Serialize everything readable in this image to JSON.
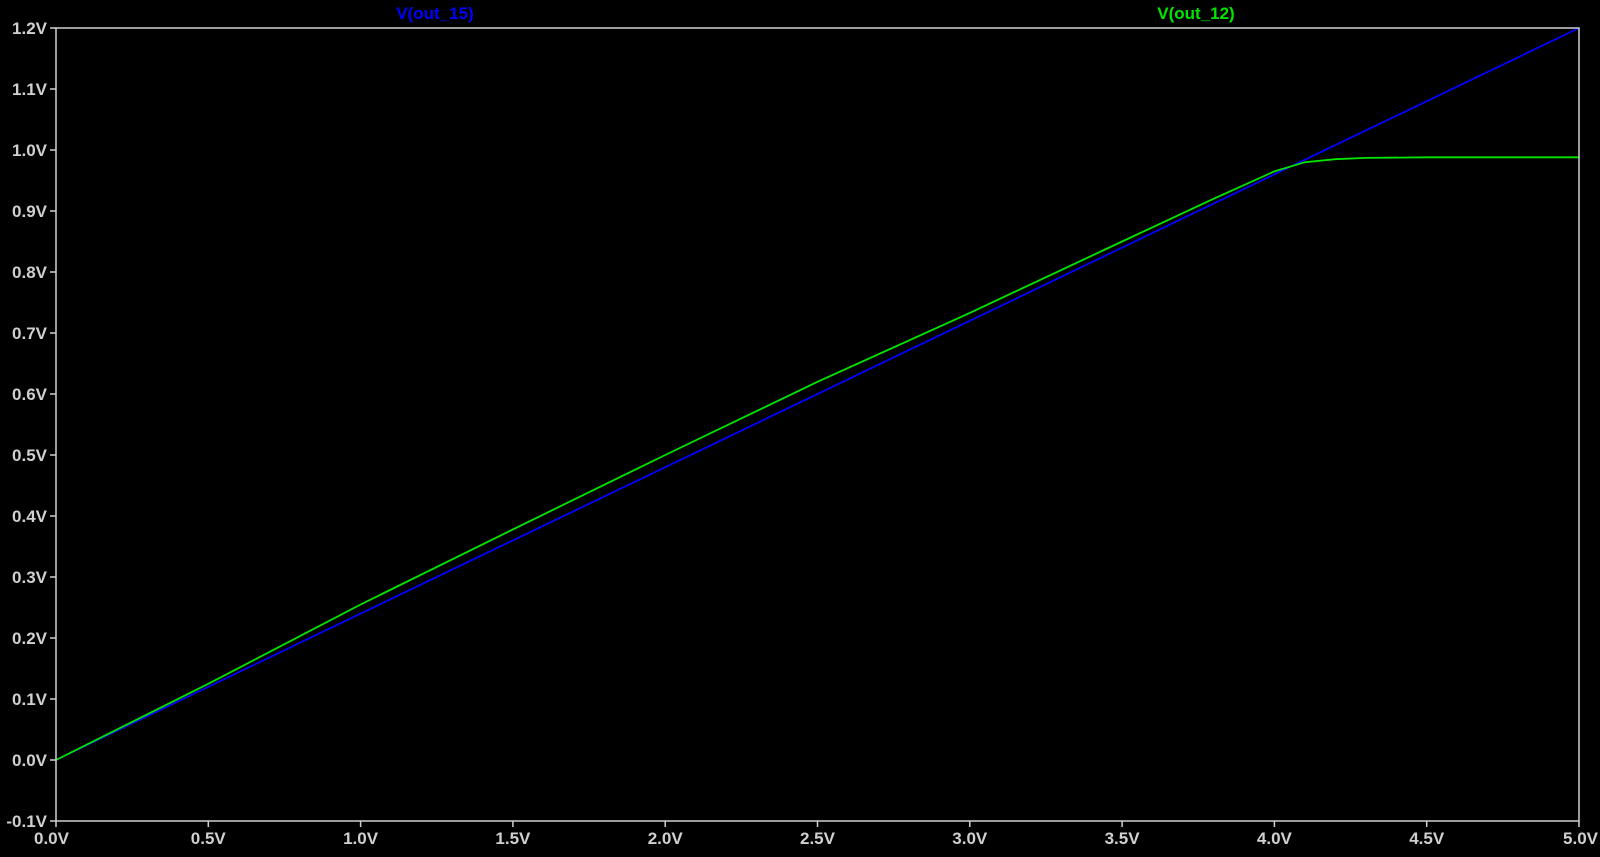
{
  "chart_data": {
    "type": "line",
    "title": "",
    "xlabel": "",
    "ylabel": "",
    "xlim": [
      0,
      5
    ],
    "ylim": [
      -0.1,
      1.2
    ],
    "grid": false,
    "x_ticks": [
      "0.0V",
      "0.5V",
      "1.0V",
      "1.5V",
      "2.0V",
      "2.5V",
      "3.0V",
      "3.5V",
      "4.0V",
      "4.5V",
      "5.0V"
    ],
    "x_tick_values": [
      0,
      0.5,
      1,
      1.5,
      2,
      2.5,
      3,
      3.5,
      4,
      4.5,
      5
    ],
    "y_ticks": [
      "-0.1V",
      "0.0V",
      "0.1V",
      "0.2V",
      "0.3V",
      "0.4V",
      "0.5V",
      "0.6V",
      "0.7V",
      "0.8V",
      "0.9V",
      "1.0V",
      "1.1V",
      "1.2V"
    ],
    "y_tick_values": [
      -0.1,
      0,
      0.1,
      0.2,
      0.3,
      0.4,
      0.5,
      0.6,
      0.7,
      0.8,
      0.9,
      1.0,
      1.1,
      1.2
    ],
    "series": [
      {
        "name": "V(out_15)",
        "color": "#0000ff",
        "x": [
          0,
          5
        ],
        "y": [
          0,
          1.2
        ]
      },
      {
        "name": "V(out_12)",
        "color": "#00e600",
        "x": [
          0,
          0.5,
          1.0,
          1.5,
          2.0,
          2.5,
          3.0,
          3.5,
          3.8,
          4.0,
          4.1,
          4.2,
          4.3,
          4.5,
          5.0
        ],
        "y": [
          0,
          0.125,
          0.255,
          0.378,
          0.5,
          0.62,
          0.733,
          0.85,
          0.92,
          0.965,
          0.98,
          0.985,
          0.987,
          0.988,
          0.988
        ]
      }
    ]
  },
  "colors": {
    "background": "#000000",
    "frame": "#d0d0d0",
    "tick_text": "#d0d0d0"
  }
}
